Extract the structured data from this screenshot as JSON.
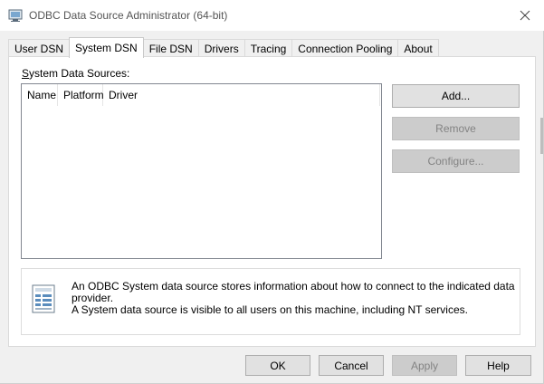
{
  "window": {
    "title": "ODBC Data Source Administrator (64-bit)"
  },
  "tabs": [
    {
      "label": "User DSN",
      "active": false
    },
    {
      "label": "System DSN",
      "active": true
    },
    {
      "label": "File DSN",
      "active": false
    },
    {
      "label": "Drivers",
      "active": false
    },
    {
      "label": "Tracing",
      "active": false
    },
    {
      "label": "Connection Pooling",
      "active": false
    },
    {
      "label": "About",
      "active": false
    }
  ],
  "system_dsn": {
    "section_label_prefix": "S",
    "section_label_rest": "ystem Data Sources:",
    "columns": [
      "Name",
      "Platform",
      "Driver"
    ],
    "rows": [],
    "buttons": {
      "add": "Add...",
      "remove": "Remove",
      "configure": "Configure..."
    },
    "info_line1": "An ODBC System data source stores information about how to connect to the indicated data provider.",
    "info_line2": "A System data source is visible to all users on this machine, including NT services."
  },
  "footer": {
    "ok": "OK",
    "cancel": "Cancel",
    "apply": "Apply",
    "help": "Help"
  },
  "icons": {
    "app": "odbc-app-icon",
    "close": "close-icon",
    "info": "database-info-icon"
  },
  "colors": {
    "dialog_bg": "#f0f0f0",
    "panel_bg": "#ffffff",
    "button_bg": "#e1e1e1",
    "disabled_text": "#838383"
  }
}
